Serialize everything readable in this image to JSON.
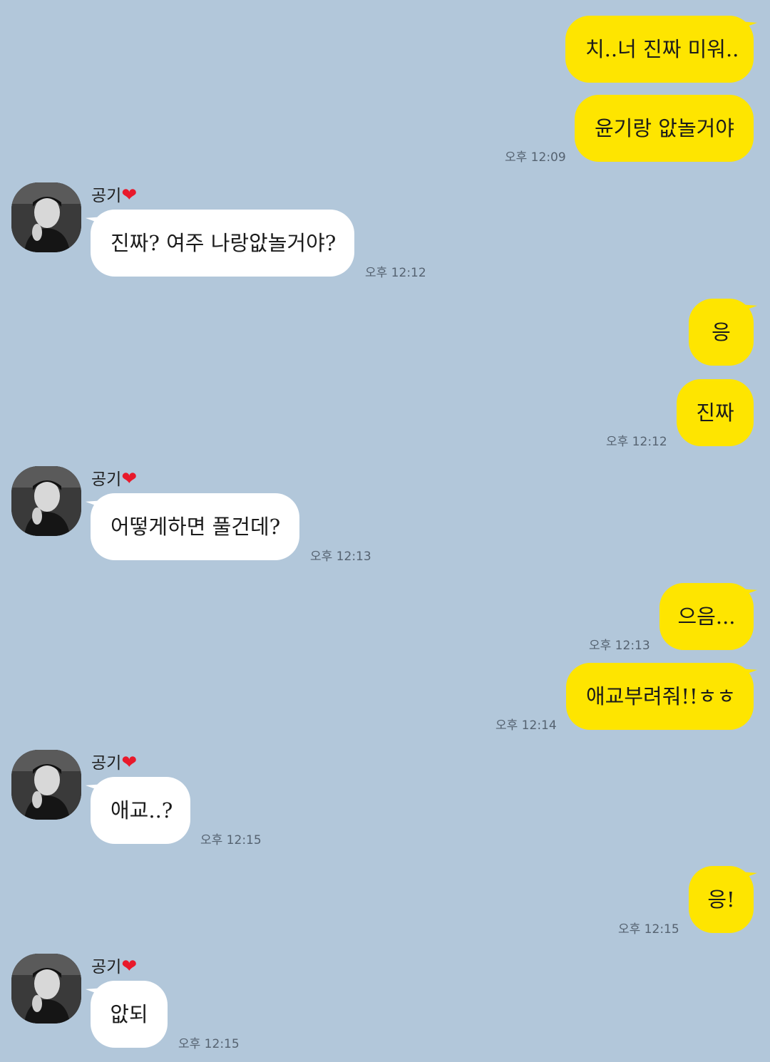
{
  "contact": {
    "name": "공기",
    "heart": "❤"
  },
  "colors": {
    "background": "#b2c7da",
    "my_bubble": "#fee500",
    "their_bubble": "#ffffff",
    "heart": "#e8192b"
  },
  "messages": [
    {
      "sender": "me",
      "text": "치..너 진짜 미워.."
    },
    {
      "sender": "me",
      "text": "윤기랑 앖놀거야",
      "time": "오후 12:09"
    },
    {
      "sender": "them",
      "text": "진짜? 여주 나랑앖놀거야?",
      "time": "오후 12:12"
    },
    {
      "sender": "me",
      "text": "응"
    },
    {
      "sender": "me",
      "text": "진짜",
      "time": "오후 12:12"
    },
    {
      "sender": "them",
      "text": "어떻게하면 풀건데?",
      "time": "오후 12:13"
    },
    {
      "sender": "me",
      "text": "으음...",
      "time": "오후 12:13"
    },
    {
      "sender": "me",
      "text": "애교부려줘!!ㅎㅎ",
      "time": "오후 12:14"
    },
    {
      "sender": "them",
      "text": "애교..?",
      "time": "오후 12:15"
    },
    {
      "sender": "me",
      "text": "응!",
      "time": "오후 12:15"
    },
    {
      "sender": "them",
      "text": "앖되",
      "time": "오후 12:15"
    }
  ]
}
